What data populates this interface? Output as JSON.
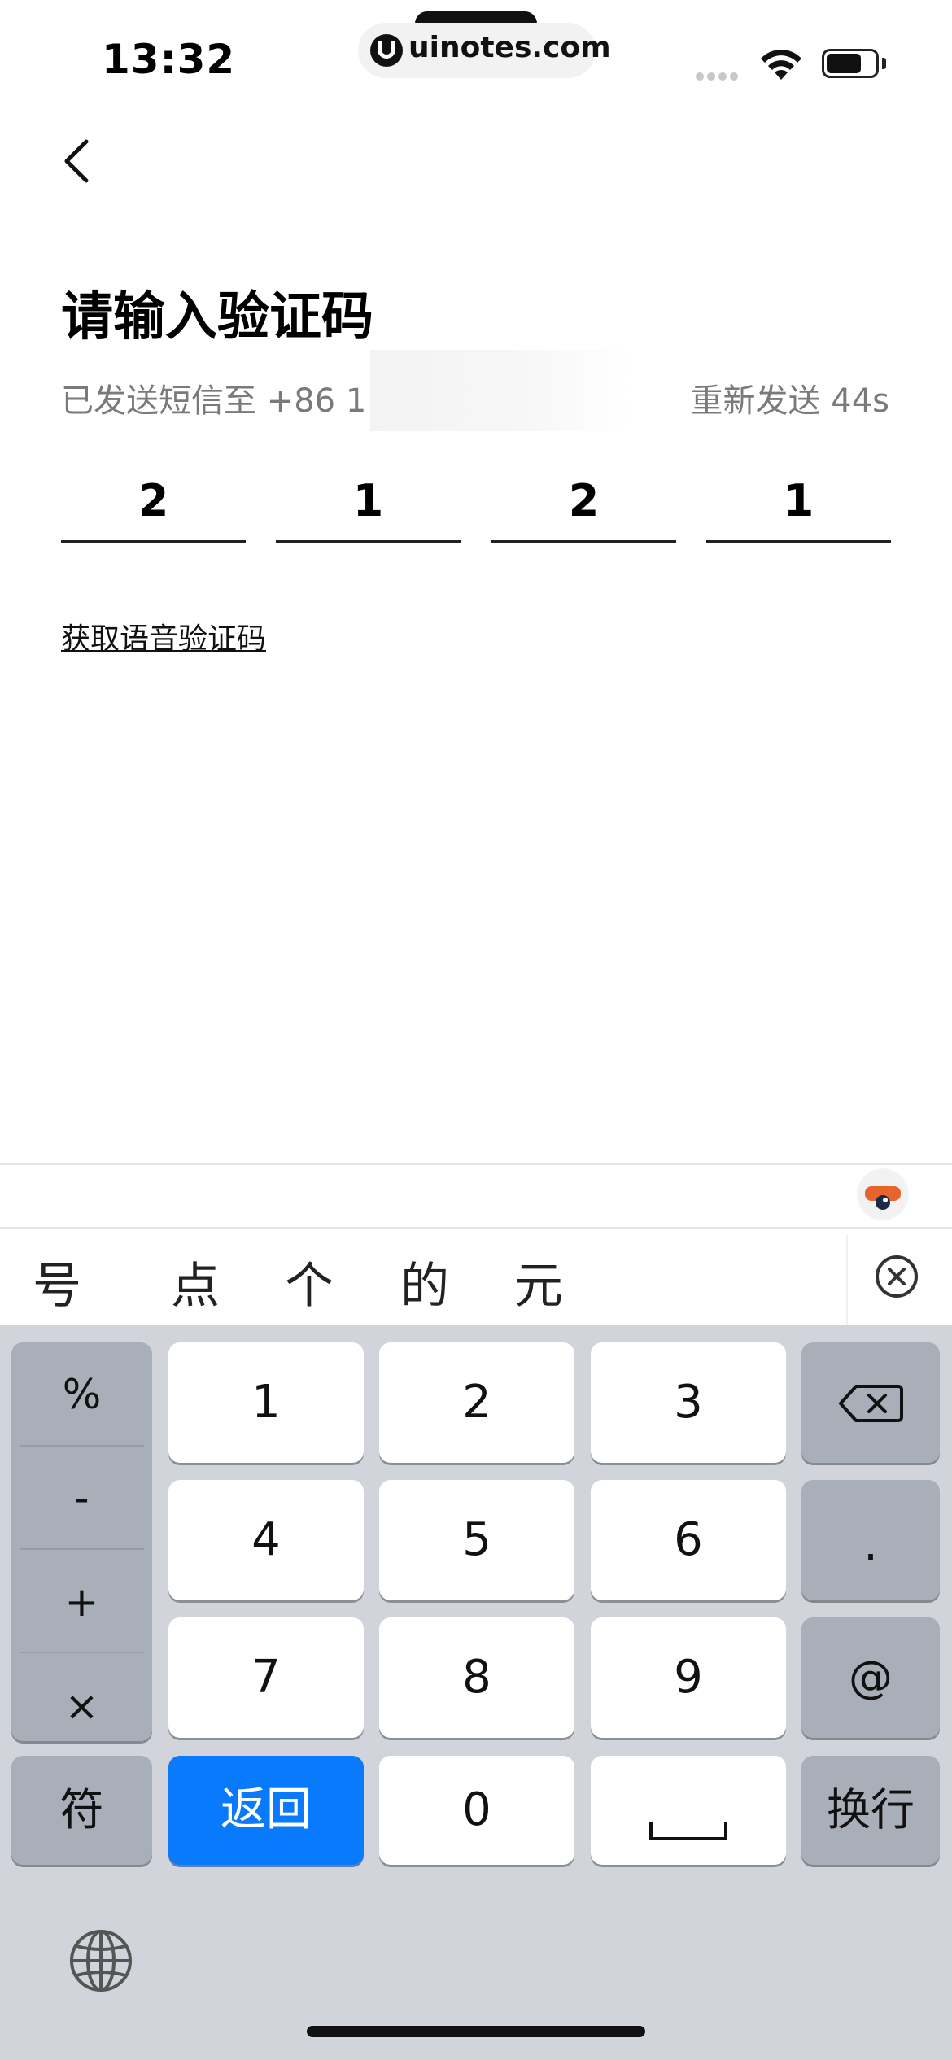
{
  "status": {
    "time": "13:32",
    "url": "uinotes.com"
  },
  "page": {
    "title": "请输入验证码",
    "sms_text": "已发送短信至 +86 1",
    "resend": "重新发送 44s",
    "code": [
      "2",
      "1",
      "2",
      "1"
    ],
    "voice_link": "获取语音验证码"
  },
  "keyboard": {
    "candidates": [
      "号",
      "点",
      "个",
      "的",
      "元"
    ],
    "symbols": [
      "%",
      "-",
      "+",
      "×"
    ],
    "digits": [
      "1",
      "2",
      "3",
      "4",
      "5",
      "6",
      "7",
      "8",
      "9"
    ],
    "dot": ".",
    "at": "@",
    "fu": "符",
    "return_label": "返回",
    "zero": "0",
    "newline": "换行"
  },
  "colors": {
    "accent": "#0a7afc",
    "keyboard_bg": "#d1d4db"
  }
}
